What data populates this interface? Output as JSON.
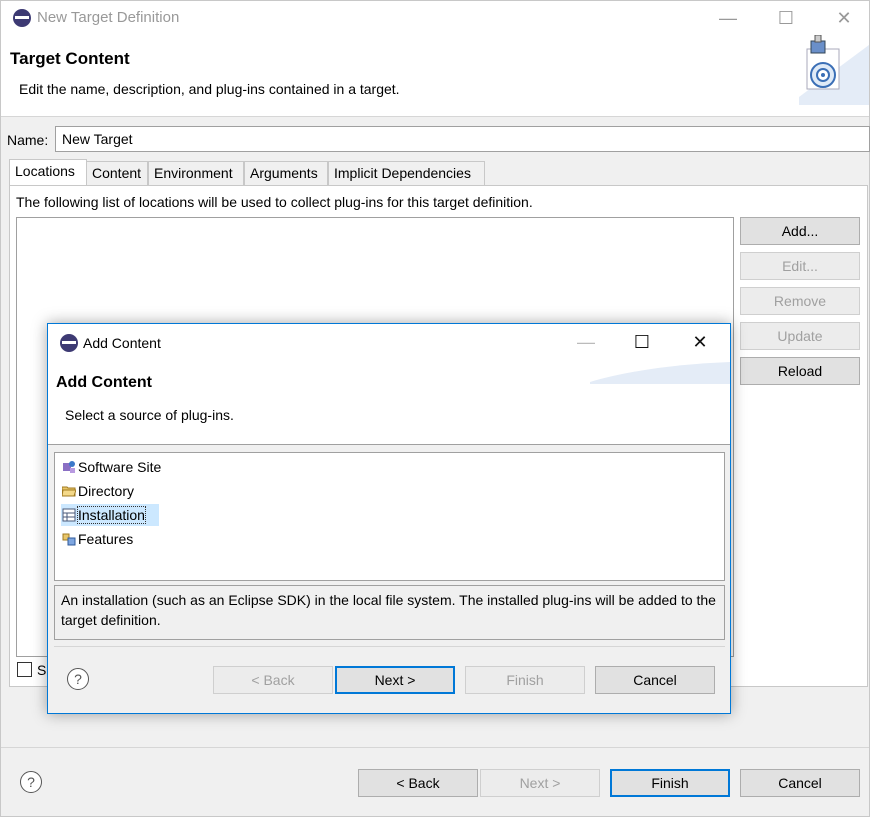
{
  "window": {
    "title": "New Target Definition",
    "header_title": "Target Content",
    "header_description": "Edit the name, description, and plug-ins contained in a target."
  },
  "name_field": {
    "label": "Name:",
    "value": "New Target"
  },
  "tabs": [
    {
      "label": "Locations",
      "active": true
    },
    {
      "label": "Content",
      "active": false
    },
    {
      "label": "Environment",
      "active": false
    },
    {
      "label": "Arguments",
      "active": false
    },
    {
      "label": "Implicit Dependencies",
      "active": false
    }
  ],
  "locations_panel": {
    "description": "The following list of locations will be used to collect plug-ins for this target definition.",
    "show_checkbox_label_visible": "Sh",
    "buttons": {
      "add": "Add...",
      "edit": "Edit...",
      "remove": "Remove",
      "update": "Update",
      "reload": "Reload"
    }
  },
  "footer": {
    "help_glyph": "?",
    "back": "< Back",
    "next": "Next >",
    "finish": "Finish",
    "cancel": "Cancel"
  },
  "dialog": {
    "title": "Add Content",
    "header_title": "Add Content",
    "header_description": "Select a source of plug-ins.",
    "sources": [
      {
        "label": "Software Site",
        "icon": "software-site-icon"
      },
      {
        "label": "Directory",
        "icon": "folder-icon"
      },
      {
        "label": "Installation",
        "icon": "installation-icon",
        "selected": true
      },
      {
        "label": "Features",
        "icon": "features-icon"
      }
    ],
    "selected_description": "An installation (such as an Eclipse SDK) in the local file system. The installed plug-ins will be added to the target definition.",
    "footer": {
      "help_glyph": "?",
      "back": "< Back",
      "next": "Next >",
      "finish": "Finish",
      "cancel": "Cancel"
    }
  }
}
